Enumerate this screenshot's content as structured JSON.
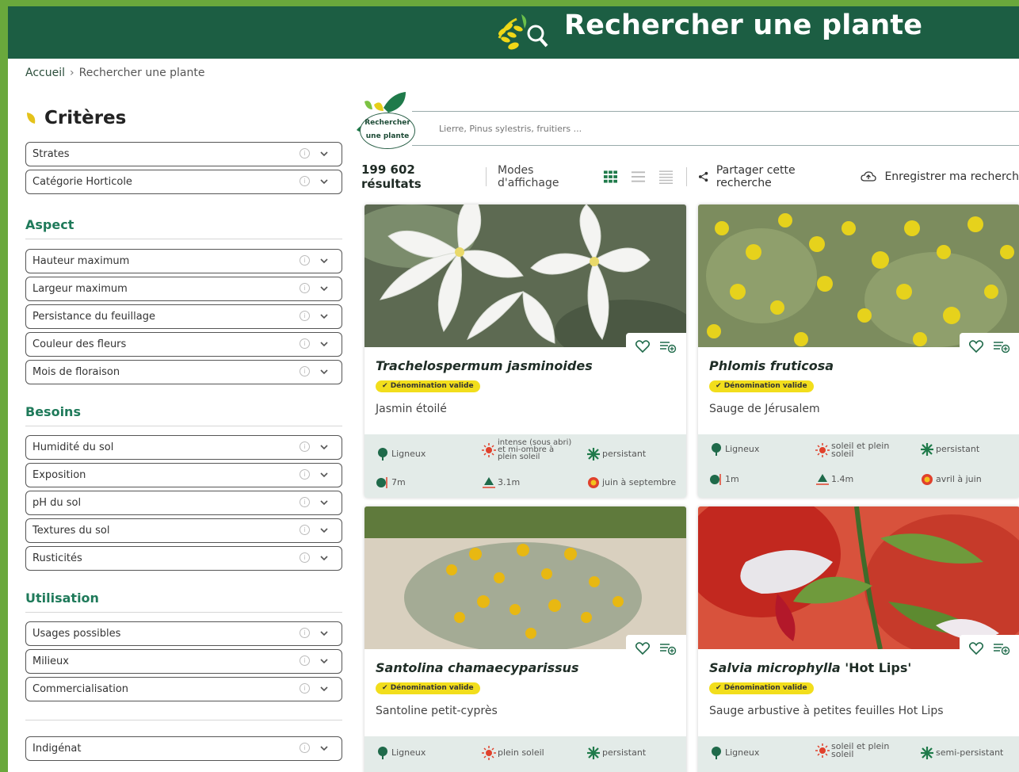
{
  "header": {
    "title": "Rechercher une plante"
  },
  "breadcrumb": {
    "home": "Accueil",
    "separator": "›",
    "current": "Rechercher une plante"
  },
  "sidebar": {
    "title": "Critères",
    "top_filters": [
      "Strates",
      "Catégorie Horticole"
    ],
    "sections": [
      {
        "label": "Aspect",
        "filters": [
          "Hauteur maximum",
          "Largeur maximum",
          "Persistance du feuillage",
          "Couleur des fleurs",
          "Mois de floraison"
        ]
      },
      {
        "label": "Besoins",
        "filters": [
          "Humidité du sol",
          "Exposition",
          "pH du sol",
          "Textures du sol",
          "Rusticités"
        ]
      },
      {
        "label": "Utilisation",
        "filters": [
          "Usages possibles",
          "Milieux",
          "Commercialisation"
        ]
      }
    ],
    "bottom_filters": [
      "Indigénat"
    ]
  },
  "search": {
    "badge_line1": "Rechercher",
    "badge_line2": "une plante",
    "placeholder": "Lierre, Pinus sylestris, fruitiers ..."
  },
  "toolbar": {
    "count": "199 602 résultats",
    "modes_label": "Modes d'affichage",
    "share_label": "Partager cette recherche",
    "save_label": "Enregistrer ma recherch"
  },
  "cards": [
    {
      "latin": "Trachelospermum jasminoides",
      "badge": "Dénomination valide",
      "common": "Jasmin étoilé",
      "type": "Ligneux",
      "exposure": "intense (sous abri) et mi-ombre à plein soleil",
      "foliage": "persistant",
      "height": "7m",
      "width": "3.1m",
      "flowering": "juin à septembre"
    },
    {
      "latin": "Phlomis fruticosa",
      "badge": "Dénomination valide",
      "common": "Sauge de Jérusalem",
      "type": "Ligneux",
      "exposure": "soleil et plein soleil",
      "foliage": "persistant",
      "height": "1m",
      "width": "1.4m",
      "flowering": "avril à juin"
    },
    {
      "latin": "Santolina chamaecyparissus",
      "badge": "Dénomination valide",
      "common": "Santoline petit-cyprès",
      "type": "Ligneux",
      "exposure": "plein soleil",
      "foliage": "persistant",
      "height": "",
      "width": "",
      "flowering": ""
    },
    {
      "latin": "Salvia microphylla",
      "cultivar": "'Hot Lips'",
      "badge": "Dénomination valide",
      "common": "Sauge arbustive à petites feuilles Hot Lips",
      "type": "Ligneux",
      "exposure": "soleil et plein soleil",
      "foliage": "semi-persistant",
      "height": "",
      "width": "",
      "flowering": ""
    }
  ],
  "colors": {
    "header_bg": "#1c5e43",
    "accent_green": "#1f7a5a",
    "badge_yellow": "#f2de1c",
    "traits_bg": "#e3ebe8",
    "outer_border": "#6aa83c"
  }
}
